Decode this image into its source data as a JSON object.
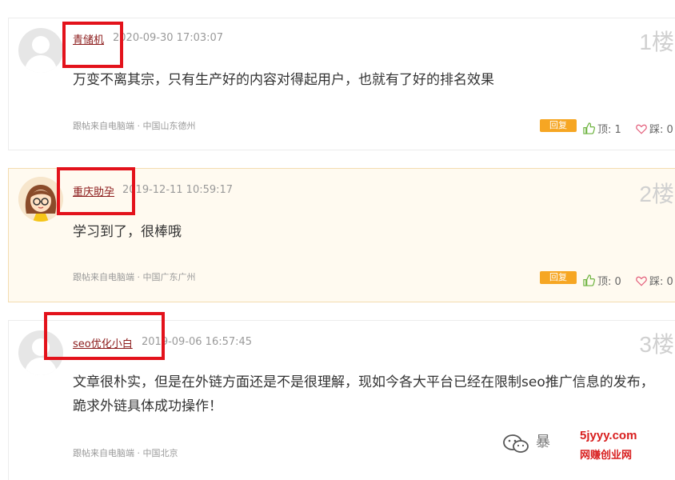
{
  "comments": [
    {
      "user": "青储机",
      "time": "2020-09-30 17:03:07",
      "floor": "1楼",
      "content": "万变不离其宗，只有生产好的内容对得起用户，也就有了好的排名效果",
      "source": "跟帖来自电脑端 · 中国山东德州",
      "reply_label": "回复",
      "up_label": "顶: 1",
      "down_label": "踩: 0"
    },
    {
      "user": "重庆助孕",
      "time": "2019-12-11 10:59:17",
      "floor": "2楼",
      "content": "学习到了，很棒哦",
      "source": "跟帖来自电脑端 · 中国广东广州",
      "reply_label": "回复",
      "up_label": "顶: 0",
      "down_label": "踩: 0"
    },
    {
      "user": "seo优化小白",
      "time": "2019-09-06 16:57:45",
      "floor": "3楼",
      "content": "文章很朴实，但是在外链方面还是不是很理解，现如今各大平台已经在限制seo推广信息的发布，跪求外链具体成功操作！",
      "source": "跟帖来自电脑端 · 中国北京"
    }
  ],
  "watermark": {
    "partial_text": "暴",
    "site": "5jyyy.com",
    "name": "网赚创业网"
  },
  "colors": {
    "username": "#8b1a1a",
    "reply_button": "#f6a623",
    "highlight_box": "#e3121b",
    "highlight_bg": "#fffaf0"
  }
}
